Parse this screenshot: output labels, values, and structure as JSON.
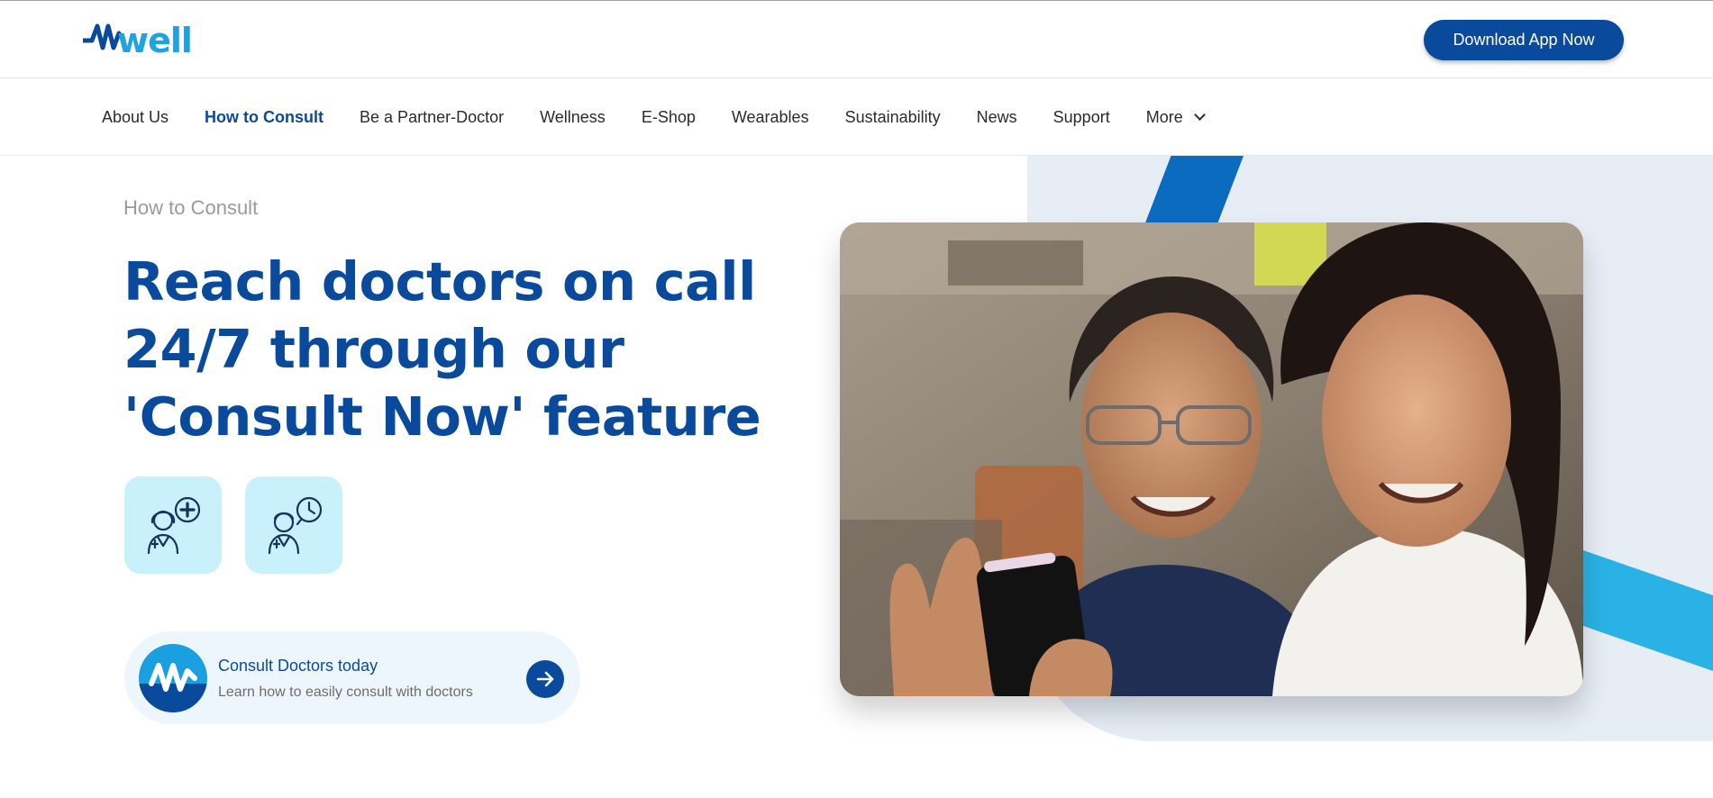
{
  "brand": {
    "name": "well"
  },
  "header": {
    "download_label": "Download App Now"
  },
  "nav": {
    "items": [
      {
        "label": "About Us"
      },
      {
        "label": "How to Consult"
      },
      {
        "label": "Be a Partner-Doctor"
      },
      {
        "label": "Wellness"
      },
      {
        "label": "E-Shop"
      },
      {
        "label": "Wearables"
      },
      {
        "label": "Sustainability"
      },
      {
        "label": "News"
      },
      {
        "label": "Support"
      },
      {
        "label": "More"
      }
    ],
    "active_index": 1
  },
  "hero": {
    "breadcrumb": "How to Consult",
    "headline_lines": [
      "Reach doctors on call",
      "24/7 through our",
      "'Consult Now' feature"
    ],
    "features": [
      {
        "icon": "female-doctor-plus-icon"
      },
      {
        "icon": "male-doctor-clock-icon"
      }
    ],
    "card": {
      "title": "Consult Doctors today",
      "subtitle": "Learn how to easily consult with doctors",
      "icon": "arrow-right-icon"
    }
  },
  "colors": {
    "primary": "#0a4a9c",
    "accent": "#1fa3e0",
    "feature_tile": "#c8f1fb",
    "panel": "#e6edf5"
  }
}
